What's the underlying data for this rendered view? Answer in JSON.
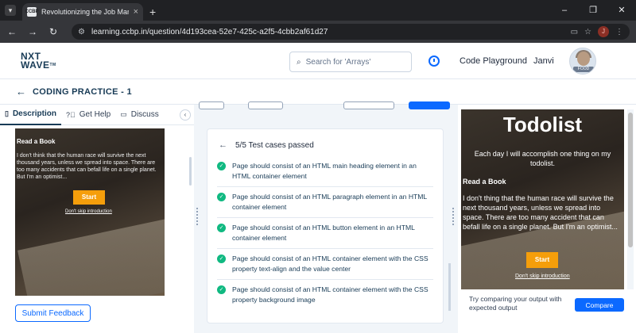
{
  "browser": {
    "tab_title": "Revolutionizing the Job Market",
    "favicon_text": "CCBP",
    "url": "learning.ccbp.in/question/4d193cea-52e7-425c-a2f5-4cbb2af61d27",
    "profile_initial": "J"
  },
  "header": {
    "logo_line1": "NXT",
    "logo_line2": "WAVE",
    "logo_tm": "TM",
    "search_placeholder": "Search for 'Arrays'",
    "code_playground": "Code Playground",
    "user_name": "Janvi",
    "avatar_badge": "FOOD"
  },
  "page": {
    "title": "CODING PRACTICE - 1"
  },
  "left_tabs": [
    {
      "label": "Description",
      "icon": "document-icon"
    },
    {
      "label": "Get Help",
      "icon": "help-icon"
    },
    {
      "label": "Discuss",
      "icon": "chat-icon"
    }
  ],
  "preview": {
    "heading": "Read a Book",
    "paragraph": "I don't think that the human race will survive the next thousand years, unless we spread into space. There are too many accidents that can befall life on a single planet. But I'm an optimist...",
    "button": "Start",
    "link": "Don't skip introduction"
  },
  "submit_feedback": "Submit Feedback",
  "results": {
    "summary": "5/5 Test cases passed",
    "cases": [
      "Page should consist of an HTML main heading element in an HTML container element",
      "Page should consist of an HTML paragraph element in an HTML container element",
      "Page should consist of an HTML button element in an HTML container element",
      "Page should consist of an HTML container element with the CSS property text-align and the value center",
      "Page should consist of an HTML container element with the CSS property background image"
    ]
  },
  "output": {
    "title": "Todolist",
    "subtitle": "Each day I will accomplish one thing on my todolist.",
    "heading": "Read a Book",
    "paragraph": "I don't thing that the human race will survive the next thousand years, unless we spread into space. There are too many accident that can befall life on a single planet. But I'm an optimist...",
    "button": "Start",
    "link": "Don't skip introduction"
  },
  "compare": {
    "hint": "Try comparing your output with expected output",
    "button": "Compare"
  },
  "colors": {
    "primary": "#0b69ff",
    "brand_dark": "#183b56",
    "success": "#10b981",
    "accent_orange": "#f59e0b"
  }
}
